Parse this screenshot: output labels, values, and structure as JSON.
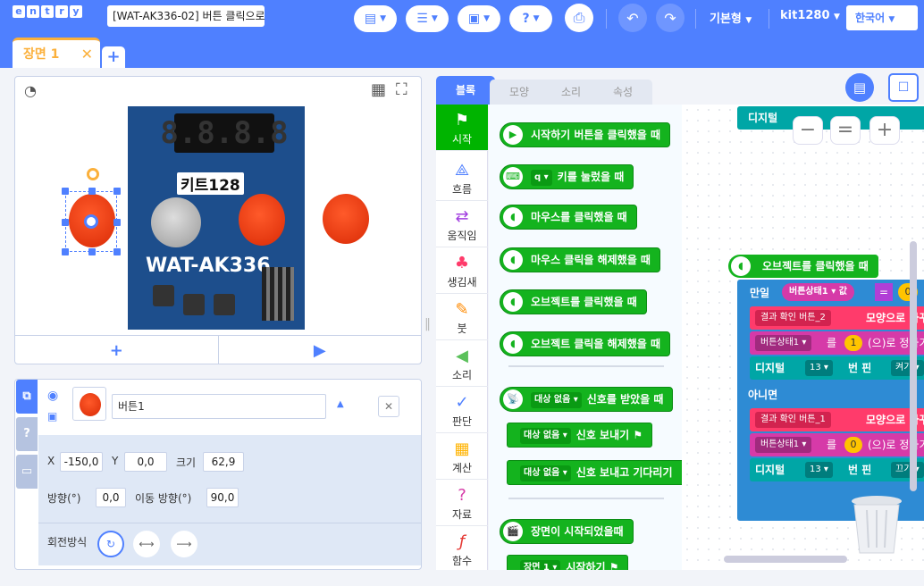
{
  "app": {
    "logo_letters": [
      "e",
      "n",
      "t",
      "r",
      "y"
    ],
    "project_title": "[WAT-AK336-02] 버튼 클릭으로",
    "menus": {
      "mode": "기본형",
      "user": "kit1280",
      "language": "한국어"
    },
    "accent": "#4f80ff"
  },
  "scene": {
    "tab_label": "장면 1",
    "close": "✕",
    "add": "+"
  },
  "stage": {
    "seg_display": "8.8.8.8",
    "label_128": "키트128",
    "label_board": "WAT-AK336",
    "add_btn": "+",
    "play_btn": "▶"
  },
  "object": {
    "name": "버튼1",
    "x_label": "X",
    "x_value": "-150,0",
    "y_label": "Y",
    "y_value": "0,0",
    "size_label": "크기",
    "size_value": "62,9",
    "dir_label": "방향(°)",
    "dir_value": "0,0",
    "move_label": "이동 방향(°)",
    "move_value": "90,0",
    "rot_label": "회전방식",
    "tabs": [
      "⧉",
      "?",
      "▭"
    ]
  },
  "tabs": [
    "블록",
    "모양",
    "소리",
    "속성"
  ],
  "categories": [
    {
      "label": "시작",
      "icon": "flag-icon"
    },
    {
      "label": "흐름",
      "icon": "flow-icon"
    },
    {
      "label": "움직임",
      "icon": "move-icon"
    },
    {
      "label": "생김새",
      "icon": "looks-icon"
    },
    {
      "label": "붓",
      "icon": "brush-icon"
    },
    {
      "label": "소리",
      "icon": "sound-icon"
    },
    {
      "label": "판단",
      "icon": "check-icon"
    },
    {
      "label": "계산",
      "icon": "calc-icon"
    },
    {
      "label": "자료",
      "icon": "data-icon"
    },
    {
      "label": "함수",
      "icon": "function-icon"
    }
  ],
  "palette": [
    {
      "text": "시작하기 버튼을 클릭했을 때"
    },
    {
      "dd": "q ▾",
      "text": "키를 눌렀을 때"
    },
    {
      "text": "마우스를 클릭했을 때"
    },
    {
      "text": "마우스 클릭을 해제했을 때"
    },
    {
      "text": "오브젝트를 클릭했을 때"
    },
    {
      "text": "오브젝트 클릭을 해제했을 때"
    },
    {
      "dd": "대상 없음 ▾",
      "text": "신호를 받았을 때"
    },
    {
      "dd": "대상 없음 ▾",
      "text": "신호 보내기"
    },
    {
      "dd": "대상 없음 ▾",
      "text": "신호 보내고 기다리기"
    },
    {
      "text": "장면이 시작되었을때"
    },
    {
      "dd": "장면 1 ▾",
      "text": "시작하기"
    }
  ],
  "code": {
    "top_label": "디지털",
    "zoom": [
      "−",
      "=",
      "+"
    ],
    "event": "오브젝트를 클릭했을 때",
    "if_label": "만일",
    "cond_var": "버튼상태1 ▾ 값",
    "cond_op": "=",
    "cond_val": "0",
    "then": [
      {
        "a": "결과 확인 버튼_2",
        "b": "모양으로 바꾸기"
      },
      {
        "a": "버튼상태1 ▾",
        "b": "를",
        "c": "1",
        "d": "(으)로 정하기"
      },
      {
        "a": "디지털",
        "b": "13 ▾",
        "c": "번 핀",
        "d": "켜기 ▾"
      }
    ],
    "else_label": "아니면",
    "else": [
      {
        "a": "결과 확인 버튼_1",
        "b": "모양으로 바꾸기"
      },
      {
        "a": "버튼상태1 ▾",
        "b": "를",
        "c": "0",
        "d": "(으)로 정하기"
      },
      {
        "a": "디지털",
        "b": "13 ▾",
        "c": "번 핀",
        "d": "끄기 ▾"
      }
    ]
  }
}
